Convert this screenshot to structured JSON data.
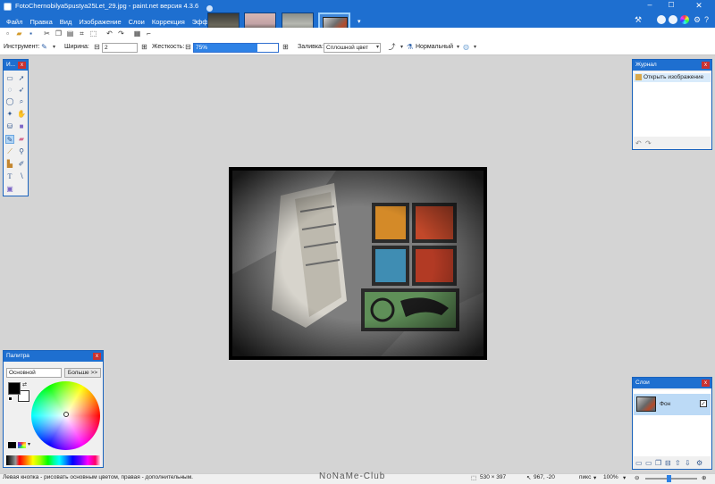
{
  "window": {
    "title": "FotoChernobilya5pustya25Let_29.jpg - paint.net версия 4.3.6",
    "menu": [
      "Файл",
      "Правка",
      "Вид",
      "Изображение",
      "Слои",
      "Коррекция",
      "Эффекты"
    ]
  },
  "toolbar": {
    "tool_label": "Инструмент:",
    "width_label": "Ширина:",
    "width_value": "2",
    "hardness_label": "Жесткость:",
    "hardness_value": "75%",
    "hardness_fraction": 0.75,
    "fill_label": "Заливка:",
    "fill_value": "Сплошной цвет",
    "blend_value": "Нормальный"
  },
  "tools_panel": {
    "title": "И..."
  },
  "history_panel": {
    "title": "Журнал",
    "items": [
      "Открыть изображение"
    ]
  },
  "layers_panel": {
    "title": "Слои",
    "layers": [
      {
        "name": "Фон",
        "visible": true
      }
    ]
  },
  "palette_panel": {
    "title": "Палитра",
    "mode": "Основной",
    "more_button": "Больше >>",
    "primary_color": "#000000",
    "secondary_color": "#ffffff"
  },
  "statusbar": {
    "hint": "Левая кнопка - рисовать основным цветом, правая - дополнительным.",
    "watermark": "NoNaMe-Club",
    "image_size": "530 × 397",
    "cursor_pos": "967, -20",
    "units": "пикс",
    "zoom": "100%"
  },
  "colors": {
    "accent": "#1e6fd0",
    "selection": "#b3d6f6",
    "close": "#c93232"
  }
}
